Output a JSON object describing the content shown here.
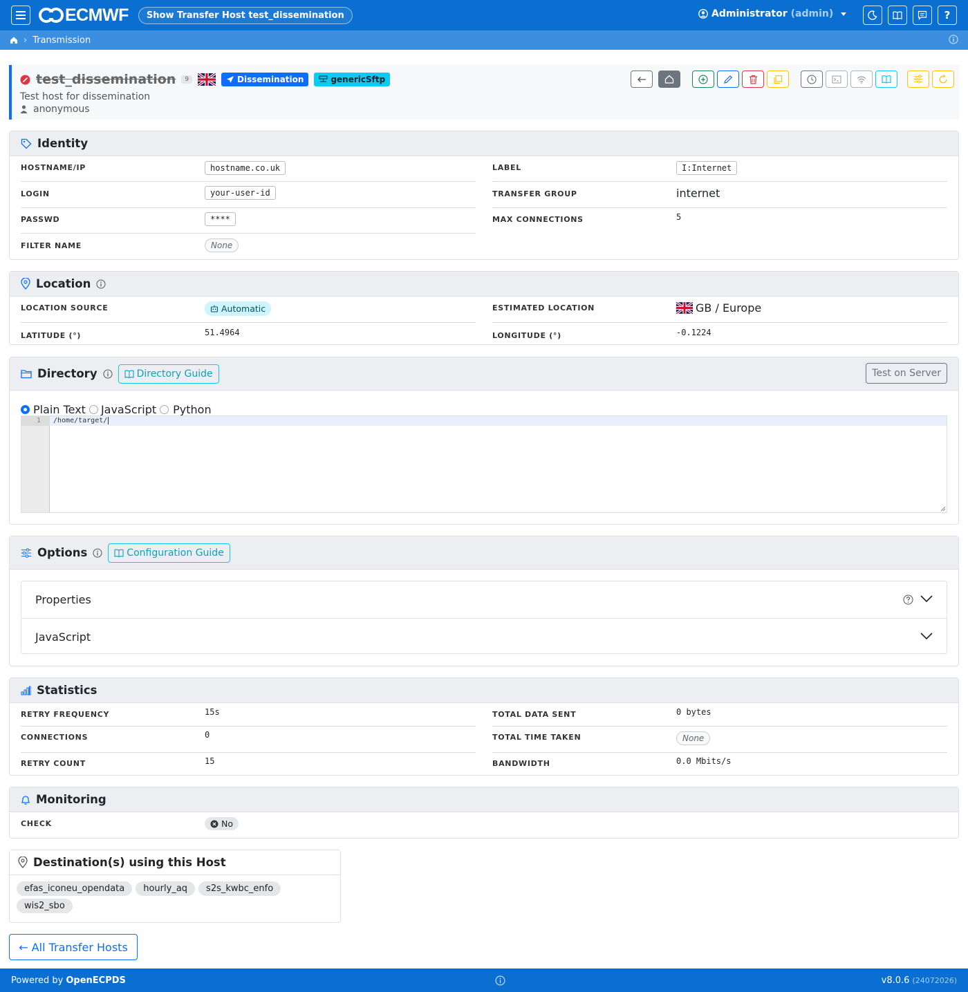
{
  "topbar": {
    "logo": "ECMWF",
    "page_title": "Show Transfer Host test_dissemination",
    "user_name": "Administrator",
    "user_role": "(admin)",
    "icons": [
      "menu-icon",
      "moon-icon",
      "book-icon",
      "chat-icon",
      "help-icon"
    ],
    "help_glyph": "?"
  },
  "breadcrumb": {
    "items": [
      "Transmission"
    ]
  },
  "host": {
    "name": "test_dissemination",
    "count": "9",
    "type_badge": "Dissemination",
    "method_badge": "genericSftp",
    "description": "Test host for dissemination",
    "owner": "anonymous"
  },
  "identity": {
    "title": "Identity",
    "hostname_label": "HOSTNAME/IP",
    "hostname": "hostname.co.uk",
    "login_label": "LOGIN",
    "login": "your-user-id",
    "passwd_label": "PASSWD",
    "passwd": "****",
    "filter_label": "FILTER NAME",
    "filter": "None",
    "label_label": "LABEL",
    "label": "I:Internet",
    "group_label": "TRANSFER GROUP",
    "group": "internet",
    "maxconn_label": "MAX CONNECTIONS",
    "maxconn": "5"
  },
  "location": {
    "title": "Location",
    "source_label": "LOCATION SOURCE",
    "source": "Automatic",
    "estimated_label": "ESTIMATED LOCATION",
    "estimated": "GB / Europe",
    "lat_label": "LATITUDE (°)",
    "lat": "51.4964",
    "lon_label": "LONGITUDE (°)",
    "lon": "-0.1224"
  },
  "directory": {
    "title": "Directory",
    "guide": "Directory Guide",
    "test_button": "Test on Server",
    "modes": [
      "Plain Text",
      "JavaScript",
      "Python"
    ],
    "selected_mode": "Plain Text",
    "line_number": "1",
    "code": "/home/target/"
  },
  "options": {
    "title": "Options",
    "guide": "Configuration Guide",
    "sections": [
      "Properties",
      "JavaScript"
    ]
  },
  "statistics": {
    "title": "Statistics",
    "retry_freq_label": "RETRY FREQUENCY",
    "retry_freq": "15s",
    "connections_label": "CONNECTIONS",
    "connections": "0",
    "retry_count_label": "RETRY COUNT",
    "retry_count": "15",
    "total_sent_label": "TOTAL DATA SENT",
    "total_sent": "0 bytes",
    "total_time_label": "TOTAL TIME TAKEN",
    "total_time": "None",
    "bandwidth_label": "BANDWIDTH",
    "bandwidth": "0.0 Mbits/s"
  },
  "monitoring": {
    "title": "Monitoring",
    "check_label": "CHECK",
    "check": "No"
  },
  "destinations": {
    "title": "Destination(s) using this Host",
    "items": [
      "efas_iconeu_opendata",
      "hourly_aq",
      "s2s_kwbc_enfo",
      "wis2_sbo"
    ]
  },
  "back_button": "← All Transfer Hosts",
  "footer": {
    "powered_prefix": "Powered by",
    "powered_name": "OpenECPDS",
    "version": "v8.0.6",
    "build": "(24072026)"
  },
  "colors": {
    "navbar": "#0a6fd0",
    "breadcrumb": "#3b8ee0",
    "primary": "#0d6efd",
    "info": "#0dcaf0",
    "danger": "#dc3545",
    "warning": "#ffc107",
    "success": "#198754"
  }
}
